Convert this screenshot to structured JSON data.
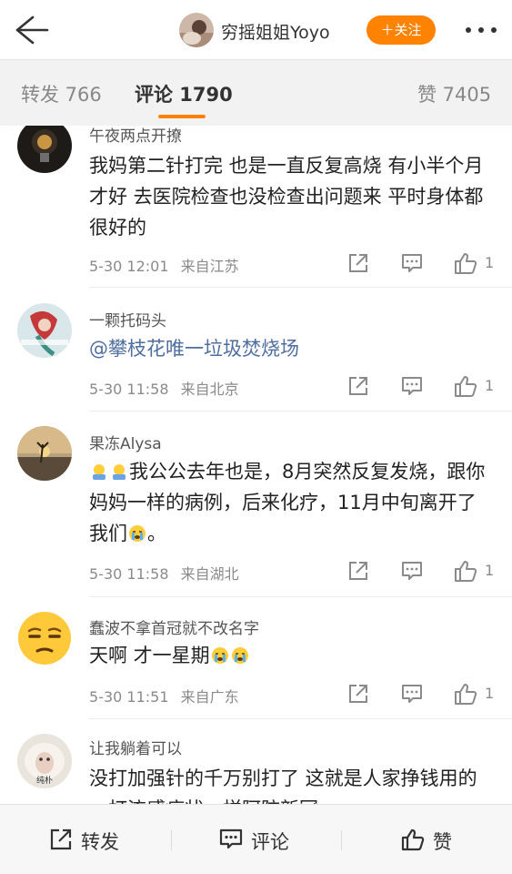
{
  "header": {
    "back_icon": "arrow-left-icon",
    "username": "穷摇姐姐Yoyo",
    "follow_label": "＋关注",
    "more_icon": "more-dots-icon"
  },
  "tabs": {
    "repost": "转发 766",
    "comment": "评论 1790",
    "like": "赞 7405"
  },
  "comments": [
    {
      "name": "午夜两点开撩",
      "text": "我妈第二针打完 也是一直反复高烧 有小半个月才好 去医院检查也没检查出问题来 平时身体都很好的",
      "time": "5-30 12:01",
      "from": "来自江苏",
      "likes": "1"
    },
    {
      "name": "一颗托码头",
      "text": "@攀枝花唯一垃圾焚烧场",
      "time": "5-30 11:58",
      "from": "来自北京",
      "likes": "1"
    },
    {
      "name": "果冻Alysa",
      "text_a": "我公公去年也是，8月突然反复发烧，跟你妈妈一样的病例，后来化疗，11月中旬离开了我们",
      "text_b": "。",
      "time": "5-30 11:58",
      "from": "来自湖北",
      "likes": "1"
    },
    {
      "name": "蠢波不拿首冠就不改名字",
      "text": "天啊 才一星期",
      "time": "5-30 11:51",
      "from": "来自广东",
      "likes": "1"
    },
    {
      "name": "让我躺着可以",
      "avatar_text": "纯朴",
      "text": "没打加强针的千万别打了 这就是人家挣钱用的一打流感症状一样阿防新冠"
    }
  ],
  "bottom": {
    "repost": "转发",
    "comment": "评论",
    "like": "赞"
  },
  "colors": {
    "accent": "#ff8200",
    "mention": "#4e6ea0"
  }
}
